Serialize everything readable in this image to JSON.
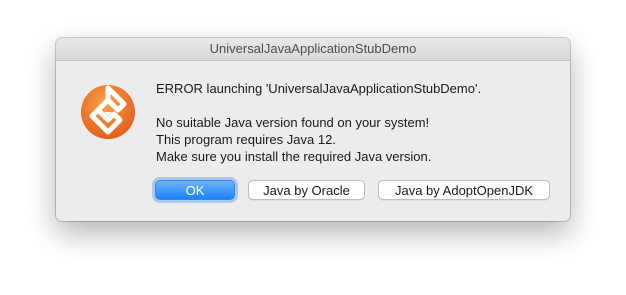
{
  "window": {
    "title": "UniversalJavaApplicationStubDemo"
  },
  "app_icon": {
    "name": "java-stub-app-icon",
    "colors": {
      "primary": "#f07a2a",
      "inner": "#ffffff"
    }
  },
  "message": {
    "headline": "ERROR launching 'UniversalJavaApplicationStubDemo'.",
    "lines": [
      "No suitable Java version found on your system!",
      "This program requires Java 12.",
      "Make sure you install the required Java version."
    ]
  },
  "buttons": {
    "ok": "OK",
    "oracle": "Java by Oracle",
    "adopt": "Java by AdoptOpenJDK"
  },
  "colors": {
    "accent": "#1a82f7"
  }
}
